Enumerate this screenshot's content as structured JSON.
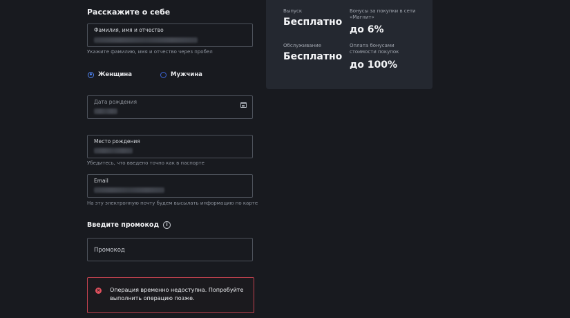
{
  "form": {
    "section_title": "Расскажите о себе",
    "full_name": {
      "label": "Фамилия, имя и отчество",
      "hint": "Укажите фамилию, имя и отчество через пробел"
    },
    "gender": {
      "female": "Женщина",
      "male": "Мужчина",
      "selected": "female"
    },
    "birth_date": {
      "label": "Дата рождения"
    },
    "birth_place": {
      "label": "Место рождения",
      "hint": "Убедитесь, что введено точно как в паспорте"
    },
    "email": {
      "label": "Email",
      "hint": "На эту электронную почту будем высылать информацию по карте"
    },
    "promo": {
      "title": "Введите промокод",
      "info_icon": "i",
      "placeholder": "Промокод"
    },
    "error": {
      "icon": "×",
      "text": "Операция временно недоступна. Попробуйте выполнить операцию позже."
    }
  },
  "card_info": {
    "issue_label": "Выпуск",
    "issue_value": "Бесплатно",
    "service_label": "Обслуживание",
    "service_value": "Бесплатно",
    "bonus_label": "Бонусы за покупки в сети «Магнит»",
    "bonus_value": "до 6%",
    "pay_label": "Оплата бонусами стоимости покупок",
    "pay_value": "до 100%"
  },
  "colors": {
    "background": "#181a1f",
    "accent": "#4f84f3",
    "error": "#c2424f",
    "card": "#242830"
  }
}
